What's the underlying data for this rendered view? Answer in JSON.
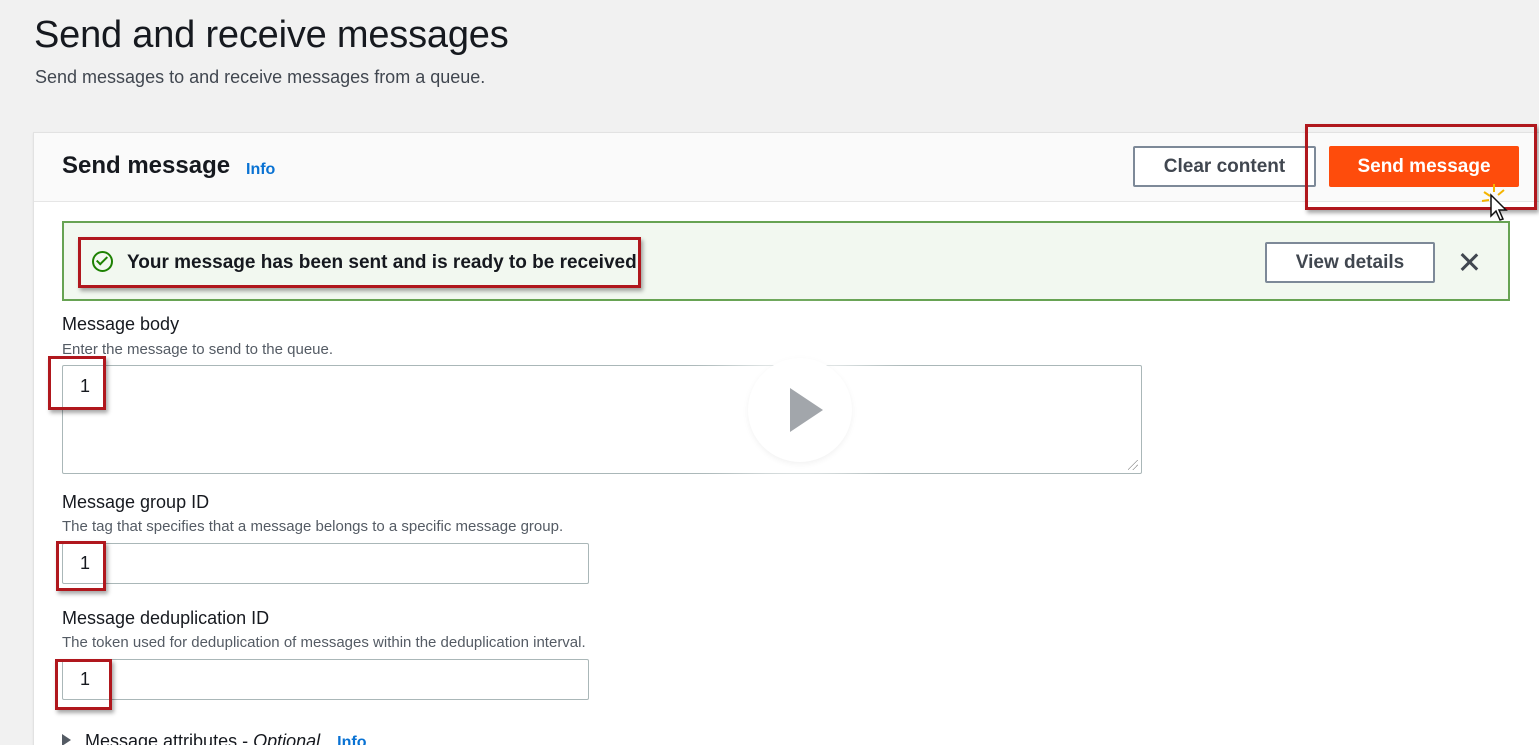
{
  "header": {
    "title": "Send and receive messages",
    "subtitle": "Send messages to and receive messages from a queue."
  },
  "panel": {
    "title": "Send message",
    "info_label": "Info",
    "clear_button": "Clear content",
    "send_button": "Send message"
  },
  "flash": {
    "text": "Your message has been sent and is ready to be received.",
    "view_details_button": "View details",
    "status_color": "#1d8102"
  },
  "fields": {
    "body": {
      "label": "Message body",
      "description": "Enter the message to send to the queue.",
      "value": "1"
    },
    "group_id": {
      "label": "Message group ID",
      "description": "The tag that specifies that a message belongs to a specific message group.",
      "value": "1"
    },
    "dedup_id": {
      "label": "Message deduplication ID",
      "description": "The token used for deduplication of messages within the deduplication interval.",
      "value": "1"
    }
  },
  "attributes": {
    "label": "Message attributes - ",
    "optional": "Optional",
    "info_label": "Info"
  },
  "colors": {
    "primary": "#fe4c0c",
    "link": "#0972d3",
    "highlight": "#b0171d"
  }
}
